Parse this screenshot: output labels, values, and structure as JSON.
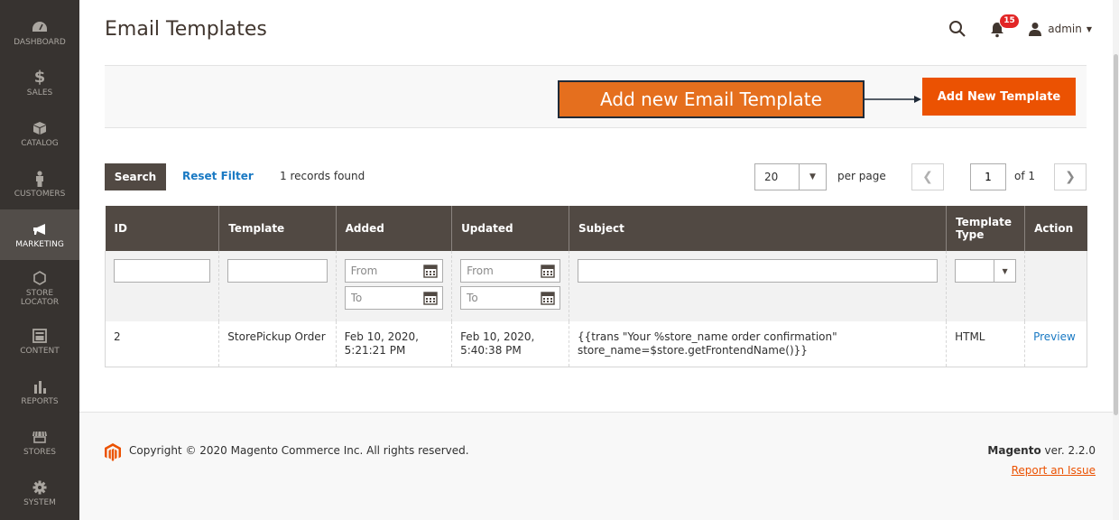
{
  "sidebar": {
    "items": [
      {
        "label": "DASHBOARD",
        "icon": "dashboard-icon"
      },
      {
        "label": "SALES",
        "icon": "dollar-icon"
      },
      {
        "label": "CATALOG",
        "icon": "cube-icon"
      },
      {
        "label": "CUSTOMERS",
        "icon": "person-icon"
      },
      {
        "label": "MARKETING",
        "icon": "megaphone-icon"
      },
      {
        "label": "STORE LOCATOR",
        "icon": "hexagon-icon"
      },
      {
        "label": "CONTENT",
        "icon": "layout-icon"
      },
      {
        "label": "REPORTS",
        "icon": "bar-chart-icon"
      },
      {
        "label": "STORES",
        "icon": "storefront-icon"
      },
      {
        "label": "SYSTEM",
        "icon": "gear-icon"
      }
    ],
    "active": "MARKETING"
  },
  "header": {
    "title": "Email Templates",
    "notification_count": "15",
    "user": "admin"
  },
  "actions": {
    "callout": "Add new Email Template",
    "add_button": "Add New Template"
  },
  "toolbar": {
    "search": "Search",
    "reset": "Reset Filter",
    "records": "1 records found",
    "per_page_value": "20",
    "per_page_label": "per page",
    "page_current": "1",
    "page_of": "of 1"
  },
  "grid": {
    "columns": [
      "ID",
      "Template",
      "Added",
      "Updated",
      "Subject",
      "Template Type",
      "Action"
    ],
    "filters": {
      "date_from": "From",
      "date_to": "To"
    },
    "rows": [
      {
        "id": "2",
        "template": "StorePickup Order",
        "added_date": "Feb 10, 2020,",
        "added_time": "5:21:21 PM",
        "updated_date": "Feb 10, 2020,",
        "updated_time": "5:40:38 PM",
        "subject_line1": "{{trans \"Your %store_name order confirmation\"",
        "subject_line2": "store_name=$store.getFrontendName()}}",
        "type": "HTML",
        "action": "Preview"
      }
    ]
  },
  "footer": {
    "copyright": "Copyright © 2020 Magento Commerce Inc. All rights reserved.",
    "brand": "Magento",
    "version": " ver. 2.2.0",
    "report": "Report an Issue"
  },
  "colors": {
    "accent": "#eb5202",
    "callout": "#e56f1e",
    "sidebar": "#373330",
    "table_header": "#514943",
    "link": "#1979c3"
  }
}
